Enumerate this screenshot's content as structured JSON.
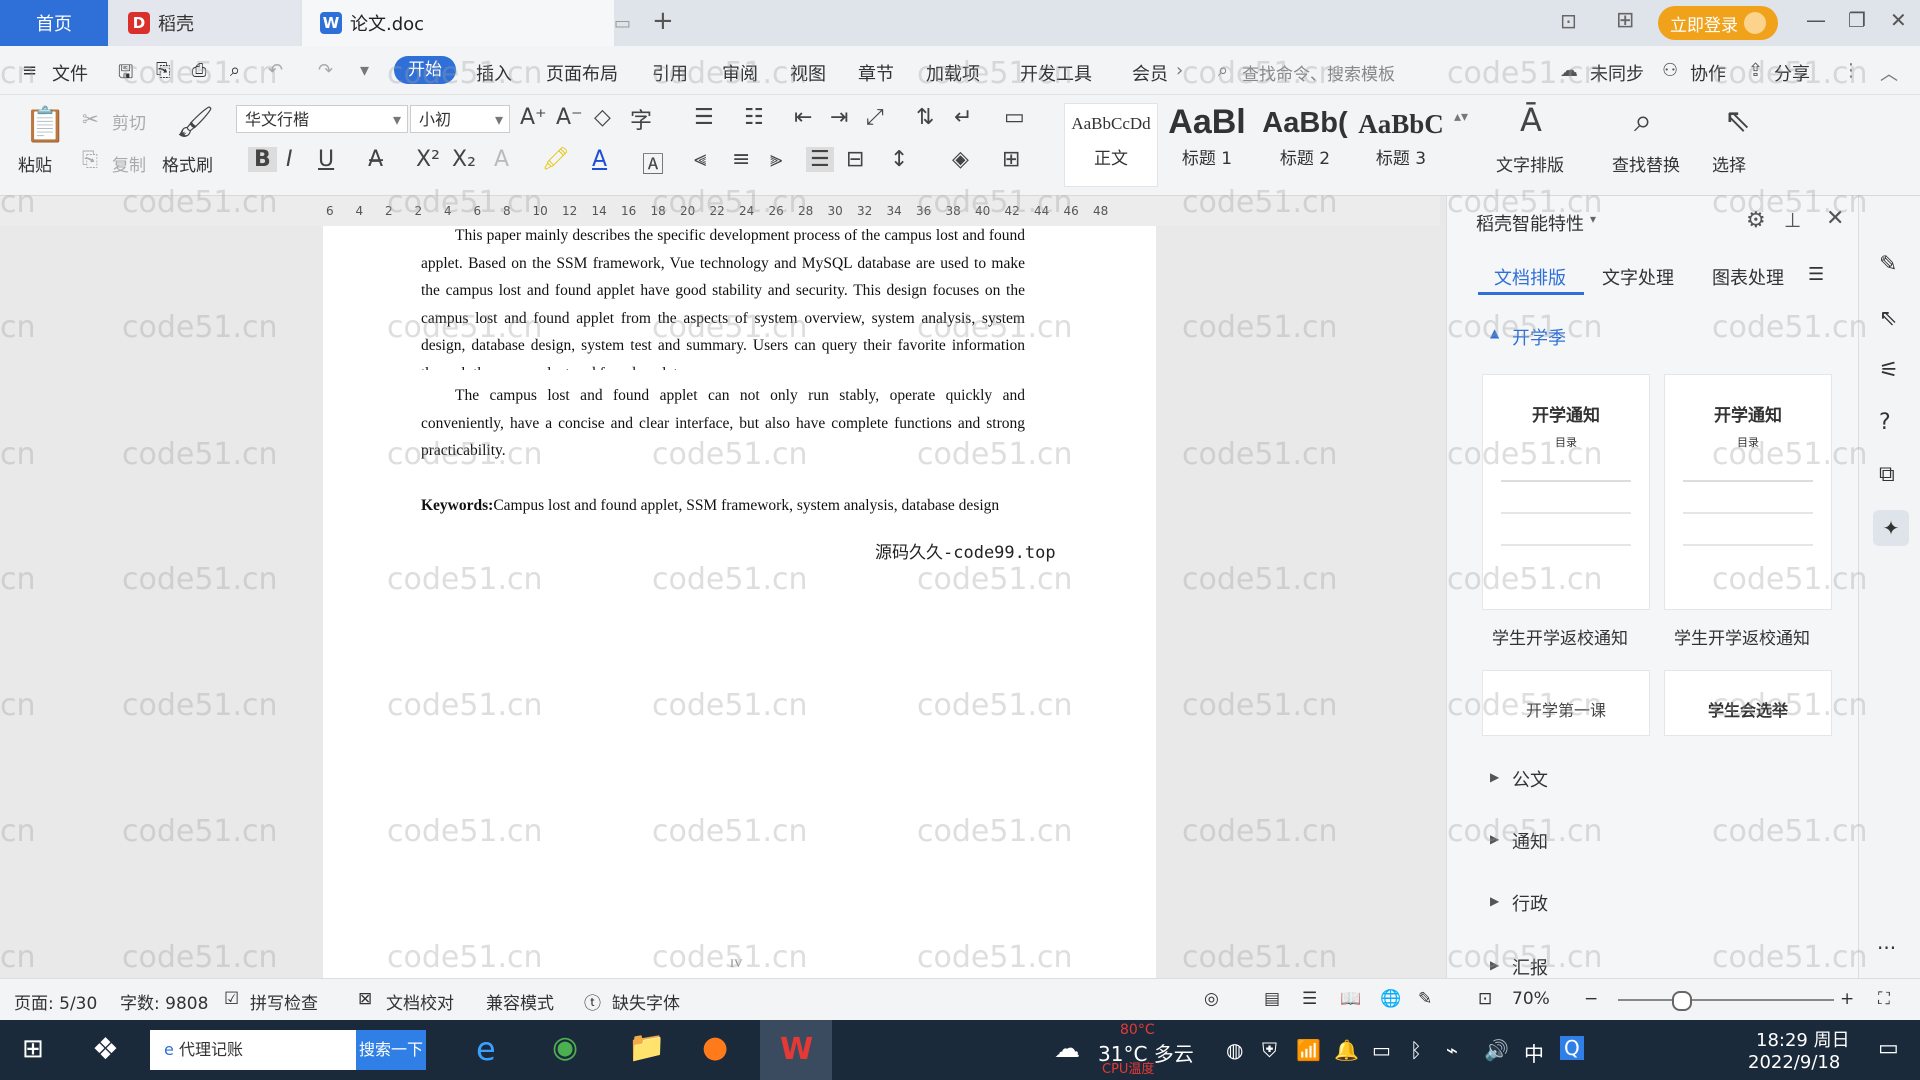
{
  "titlebar": {
    "tabs": [
      {
        "label": "首页"
      },
      {
        "label": "稻壳"
      },
      {
        "label": "论文.doc"
      }
    ],
    "login_label": "立即登录"
  },
  "menubar": {
    "file_label": "文件",
    "items": [
      "开始",
      "插入",
      "页面布局",
      "引用",
      "审阅",
      "视图",
      "章节",
      "加载项",
      "开发工具",
      "会员"
    ],
    "search_placeholder": "查找命令、搜索模板",
    "sync_label": "未同步",
    "collab_label": "协作",
    "share_label": "分享"
  },
  "ribbon": {
    "paste_label": "粘贴",
    "cut_label": "剪切",
    "copy_label": "复制",
    "format_painter_label": "格式刷",
    "font_name": "华文行楷",
    "font_size": "小初",
    "styles": [
      {
        "preview": "AaBbCcDd",
        "label": "正文"
      },
      {
        "preview": "AaBl",
        "label": "标题 1"
      },
      {
        "preview": "AaBb(",
        "label": "标题 2"
      },
      {
        "preview": "AaBbC",
        "label": "标题 3"
      }
    ],
    "text_layout_label": "文字排版",
    "find_replace_label": "查找替换",
    "select_label": "选择"
  },
  "ruler": {
    "ticks": [
      "6",
      "4",
      "2",
      "2",
      "4",
      "6",
      "8",
      "10",
      "12",
      "14",
      "16",
      "18",
      "20",
      "22",
      "24",
      "26",
      "28",
      "30",
      "32",
      "34",
      "36",
      "38",
      "40",
      "42",
      "44",
      "46",
      "48"
    ]
  },
  "document": {
    "paragraph1": "This paper mainly describes the specific development process of the campus lost and found applet. Based on the SSM framework, Vue technology and MySQL database are used to make the campus lost and found applet have good stability and security. This design focuses on the campus lost and found applet from the aspects of system overview, system analysis, system design, database design, system test and summary. Users can query their favorite information through the campus lost and found applet.",
    "paragraph2": "The campus lost and found applet can not only run stably, operate quickly and conveniently, have a concise and clear interface, but also have complete functions and strong practicability.",
    "keywords_label": "Keywords:",
    "keywords": "Campus lost and found applet, SSM framework, system analysis, database design",
    "source_note": "源码久久-code99.top",
    "page_numeral": "IV"
  },
  "panel": {
    "title": "稻壳智能特性",
    "tabs": [
      "文档排版",
      "文字处理",
      "图表处理"
    ],
    "section_open": "开学季",
    "cards": [
      {
        "title": "开学通知",
        "sub": "目录",
        "caption": "学生开学返校通知"
      },
      {
        "title": "开学通知",
        "sub": "目录",
        "caption": "学生开学返校通知"
      },
      {
        "title": "开学第一课",
        "sub": "",
        "caption": ""
      },
      {
        "title": "学生会选举",
        "sub": "",
        "caption": ""
      }
    ],
    "categories": [
      "公文",
      "通知",
      "行政",
      "汇报"
    ]
  },
  "statusbar": {
    "page": "页面: 5/30",
    "words": "字数: 9808",
    "spell_check": "拼写检查",
    "doc_check": "文档校对",
    "compat": "兼容模式",
    "missing_font": "缺失字体",
    "zoom": "70%"
  },
  "taskbar": {
    "search_text": "代理记账",
    "search_button": "搜索一下",
    "weather": "31°C 多云",
    "cpu_temp": "80°C",
    "cpu_label": "CPU温度",
    "ime": "中",
    "time": "18:29 周日",
    "date": "2022/9/18"
  },
  "watermark_text": "code51.cn",
  "colors": {
    "accent": "#2f6fd8",
    "login": "#f0a21b",
    "taskbar": "#1b2a3b"
  }
}
